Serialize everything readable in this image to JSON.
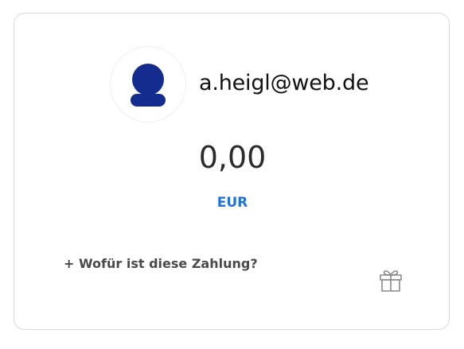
{
  "recipient": {
    "email": "a.heigl@web.de",
    "avatar_icon": "user-icon",
    "avatar_color": "#142c8e"
  },
  "payment": {
    "amount": "0,00",
    "currency": "EUR",
    "currency_color": "#1f72d8"
  },
  "note": {
    "link_label": "+ Wofür ist diese Zahlung?"
  },
  "gift": {
    "icon": "gift-icon"
  }
}
